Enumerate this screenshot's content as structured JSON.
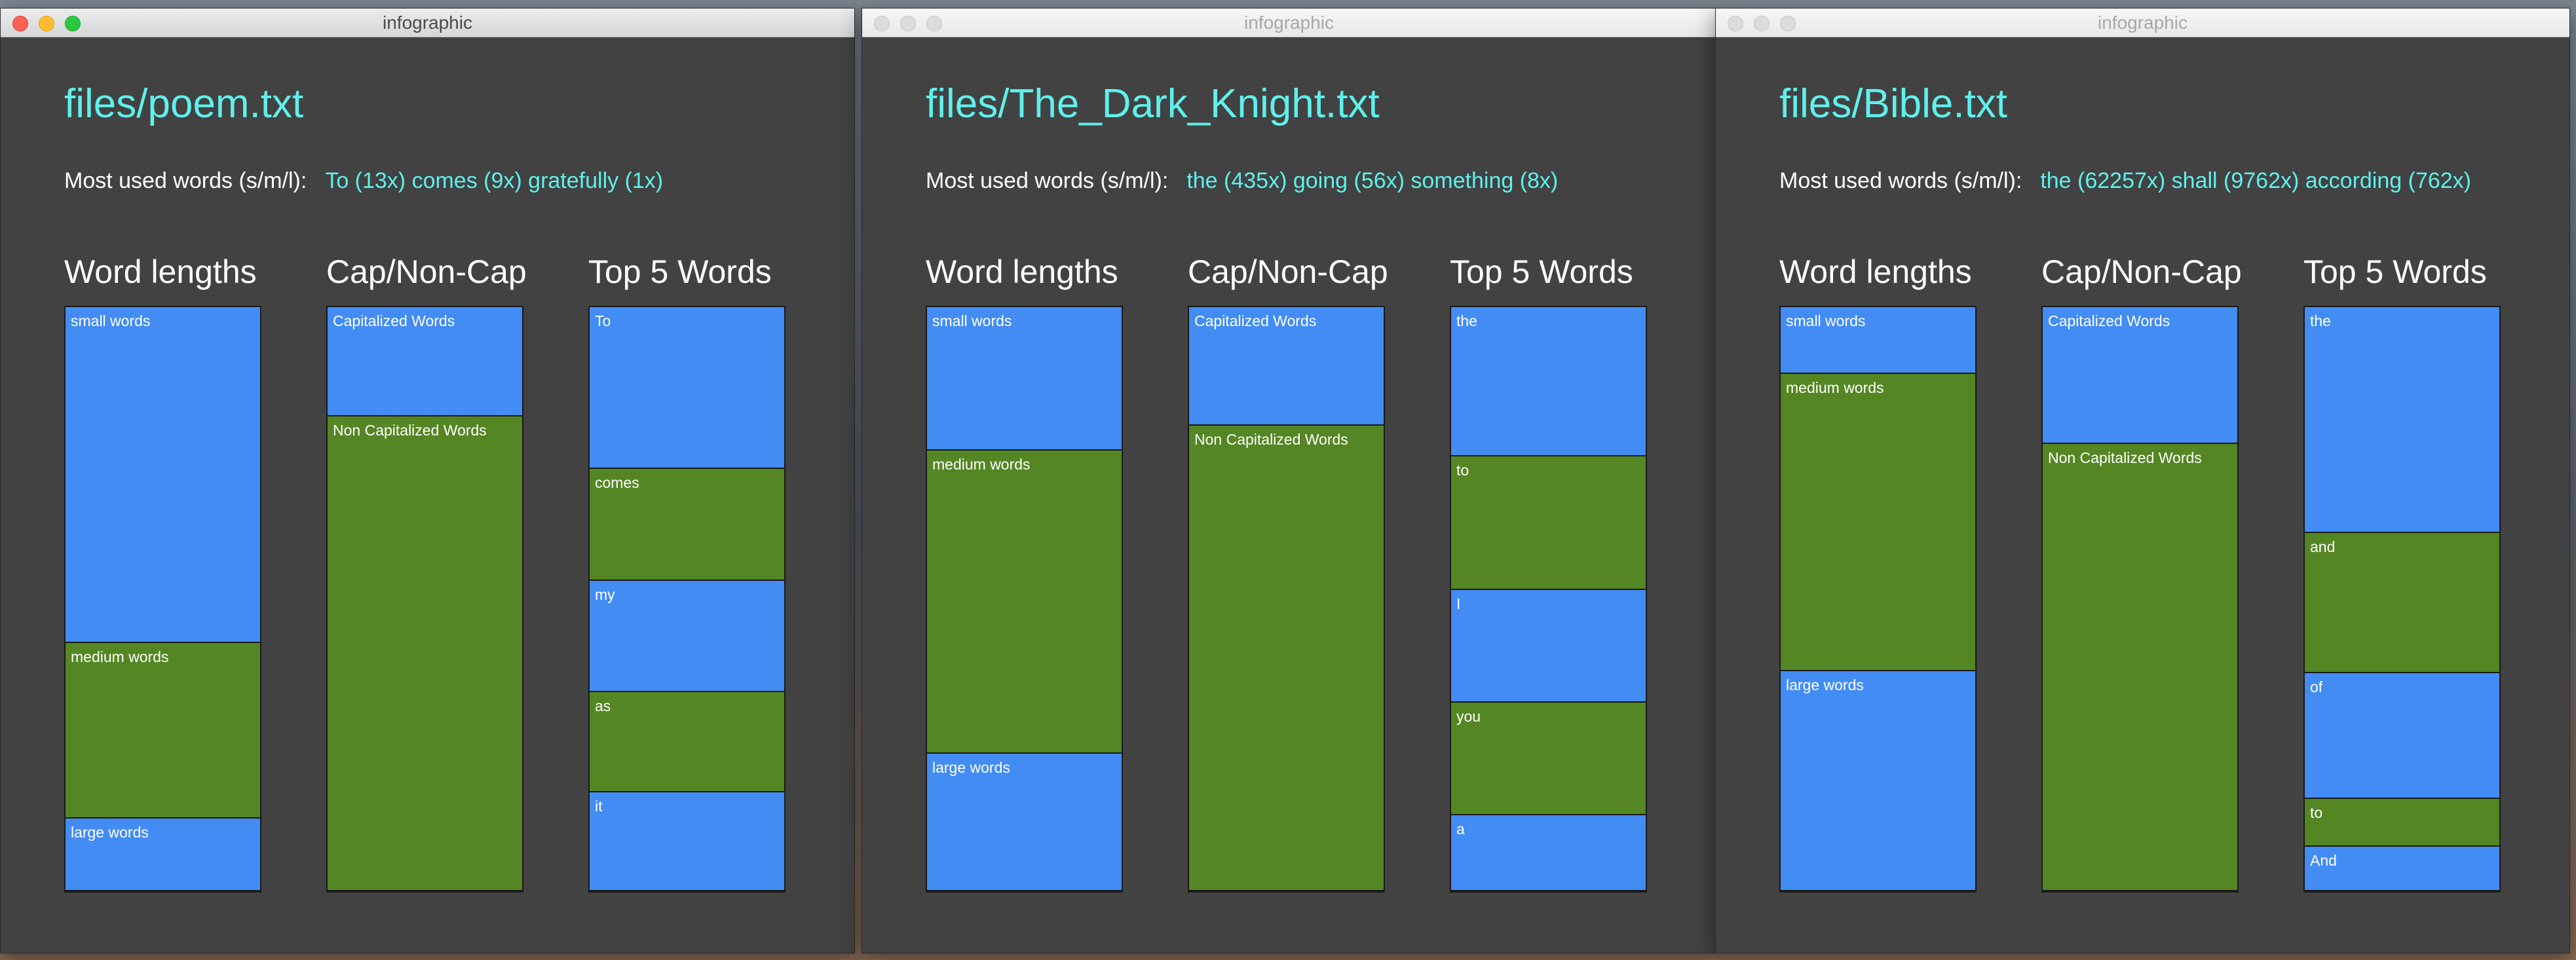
{
  "colors": {
    "blue_segment": "#428cf4",
    "green_segment": "#548624",
    "accent_cyan": "#5ff0ec",
    "window_bg": "#424242"
  },
  "windows": [
    {
      "title": "infographic",
      "active": true,
      "file": "files/poem.txt",
      "most_used_label": "Most used words (s/m/l):",
      "most_used_value": "To (13x) comes (9x) gratefully (1x)",
      "headings": {
        "lengths": "Word lengths",
        "cap": "Cap/Non-Cap",
        "top": "Top 5 Words"
      },
      "word_lengths": [
        {
          "label": "small words",
          "share": 0.575,
          "color": "blue"
        },
        {
          "label": "medium words",
          "share": 0.3,
          "color": "green"
        },
        {
          "label": "large words",
          "share": 0.125,
          "color": "blue"
        }
      ],
      "cap_noncap": [
        {
          "label": "Capitalized Words",
          "share": 0.187,
          "color": "blue"
        },
        {
          "label": "Non Capitalized Words",
          "share": 0.813,
          "color": "green"
        }
      ],
      "top_words": [
        {
          "label": "To",
          "share": 0.277,
          "color": "blue"
        },
        {
          "label": "comes",
          "share": 0.192,
          "color": "green"
        },
        {
          "label": "my",
          "share": 0.191,
          "color": "blue"
        },
        {
          "label": "as",
          "share": 0.171,
          "color": "green"
        },
        {
          "label": "it",
          "share": 0.169,
          "color": "blue"
        }
      ]
    },
    {
      "title": "infographic",
      "active": false,
      "file": "files/The_Dark_Knight.txt",
      "most_used_label": "Most used words (s/m/l):",
      "most_used_value": "the (435x) going (56x) something (8x)",
      "headings": {
        "lengths": "Word lengths",
        "cap": "Cap/Non-Cap",
        "top": "Top 5 Words"
      },
      "word_lengths": [
        {
          "label": "small words",
          "share": 0.246,
          "color": "blue"
        },
        {
          "label": "medium words",
          "share": 0.519,
          "color": "green"
        },
        {
          "label": "large words",
          "share": 0.235,
          "color": "blue"
        }
      ],
      "cap_noncap": [
        {
          "label": "Capitalized Words",
          "share": 0.203,
          "color": "blue"
        },
        {
          "label": "Non Capitalized Words",
          "share": 0.797,
          "color": "green"
        }
      ],
      "top_words": [
        {
          "label": "the",
          "share": 0.256,
          "color": "blue"
        },
        {
          "label": "to",
          "share": 0.229,
          "color": "green"
        },
        {
          "label": "I",
          "share": 0.193,
          "color": "blue"
        },
        {
          "label": "you",
          "share": 0.193,
          "color": "green"
        },
        {
          "label": "a",
          "share": 0.129,
          "color": "blue"
        }
      ]
    },
    {
      "title": "infographic",
      "active": false,
      "file": "files/Bible.txt",
      "most_used_label": "Most used words (s/m/l):",
      "most_used_value": "the (62257x) shall (9762x) according (762x)",
      "headings": {
        "lengths": "Word lengths",
        "cap": "Cap/Non-Cap",
        "top": "Top 5 Words"
      },
      "word_lengths": [
        {
          "label": "small words",
          "share": 0.114,
          "color": "blue"
        },
        {
          "label": "medium words",
          "share": 0.509,
          "color": "green"
        },
        {
          "label": "large words",
          "share": 0.377,
          "color": "blue"
        }
      ],
      "cap_noncap": [
        {
          "label": "Capitalized Words",
          "share": 0.234,
          "color": "blue"
        },
        {
          "label": "Non Capitalized Words",
          "share": 0.766,
          "color": "green"
        }
      ],
      "top_words": [
        {
          "label": "the",
          "share": 0.387,
          "color": "blue"
        },
        {
          "label": "and",
          "share": 0.24,
          "color": "green"
        },
        {
          "label": "of",
          "share": 0.215,
          "color": "blue"
        },
        {
          "label": "to",
          "share": 0.082,
          "color": "green"
        },
        {
          "label": "And",
          "share": 0.076,
          "color": "blue"
        }
      ]
    }
  ]
}
